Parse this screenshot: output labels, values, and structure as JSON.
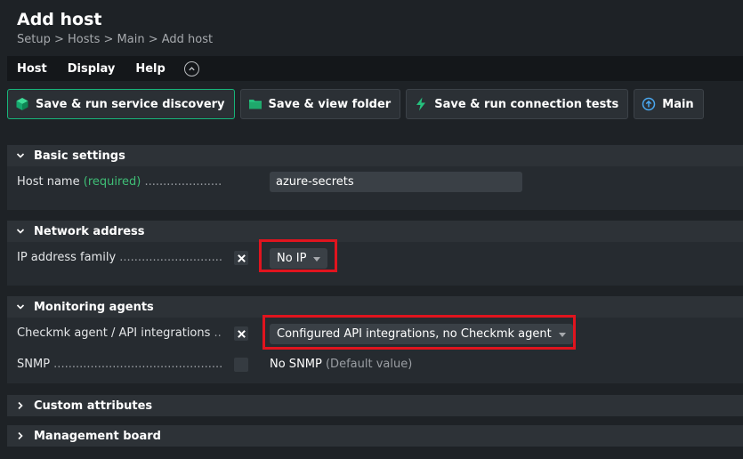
{
  "header": {
    "title": "Add host",
    "breadcrumb": "Setup > Hosts > Main > Add host"
  },
  "menubar": {
    "items": [
      "Host",
      "Display",
      "Help"
    ]
  },
  "toolbar": {
    "buttons": [
      {
        "label": "Save & run service discovery",
        "icon": "cube-icon"
      },
      {
        "label": "Save & view folder",
        "icon": "folder-icon"
      },
      {
        "label": "Save & run connection tests",
        "icon": "lightning-icon"
      },
      {
        "label": "Main",
        "icon": "arrow-up-circle-icon"
      }
    ]
  },
  "sections": {
    "basic": {
      "title": "Basic settings",
      "host_name_label": "Host name",
      "host_name_required": "(required)",
      "host_name_dots": " ................................",
      "host_name_value": "azure-secrets"
    },
    "network": {
      "title": "Network address",
      "ip_family_label": "IP address family",
      "ip_family_dots": " ............................",
      "ip_family_value": "No IP"
    },
    "monitoring": {
      "title": "Monitoring agents",
      "agent_label": "Checkmk agent / API integrations",
      "agent_dots": " ..",
      "agent_value": "Configured API integrations, no Checkmk agent",
      "snmp_label": "SNMP",
      "snmp_dots": " ............................................................",
      "snmp_value": "No SNMP",
      "snmp_default": "(Default value)"
    },
    "custom": {
      "title": "Custom attributes"
    },
    "management": {
      "title": "Management board"
    }
  },
  "colors": {
    "accent": "#17b57a",
    "required": "#3fbe76",
    "highlight": "#e0141e"
  }
}
